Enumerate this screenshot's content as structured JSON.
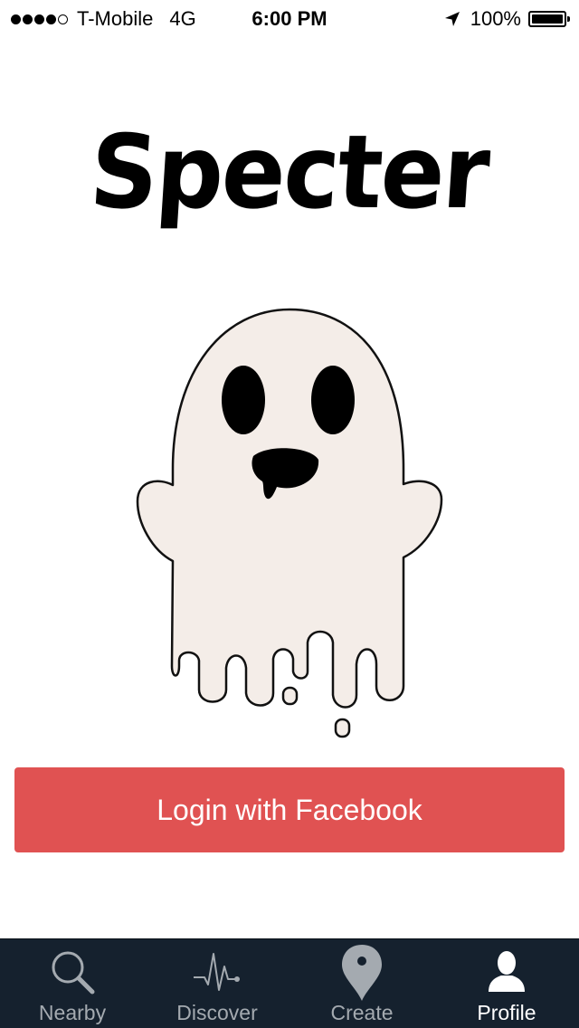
{
  "status_bar": {
    "carrier": "T-Mobile",
    "network": "4G",
    "time": "6:00 PM",
    "battery": "100%",
    "signal_bars_filled": 4,
    "signal_bars_total": 5
  },
  "app": {
    "logo_text": "Specter"
  },
  "login": {
    "button_label": "Login with Facebook"
  },
  "tab_bar": {
    "items": [
      {
        "label": "Nearby",
        "icon": "search-icon"
      },
      {
        "label": "Discover",
        "icon": "pulse-icon"
      },
      {
        "label": "Create",
        "icon": "map-pin-icon"
      },
      {
        "label": "Profile",
        "icon": "person-icon"
      }
    ],
    "active": "Profile"
  },
  "colors": {
    "button": "#e05252",
    "tab_bar_bg": "#15212e",
    "tab_inactive": "#a4aab0",
    "tab_active": "#ffffff",
    "ghost_body": "#f4ede8"
  }
}
